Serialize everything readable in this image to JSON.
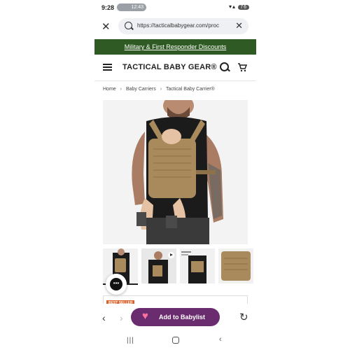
{
  "status_bar": {
    "time": "9:28",
    "pill_text": "12:43",
    "battery": "76"
  },
  "browser": {
    "url": "https://tacticalbabygear.com/proc"
  },
  "promo_banner": "Military & First Responder Discounts",
  "header": {
    "logo": "TACTICAL BABY GEAR®"
  },
  "breadcrumb": {
    "items": [
      "Home",
      "Baby Carriers",
      "Tactical Baby Carrier®"
    ]
  },
  "product": {
    "badge": "BEST SELLER"
  },
  "bottom_bar": {
    "babylist_label": "Add to Babylist"
  },
  "icons": {
    "close": "close-icon",
    "search": "search-icon",
    "cart": "cart-icon",
    "menu": "hamburger-icon",
    "back": "chevron-left-icon",
    "forward": "chevron-right-icon",
    "reload": "reload-icon",
    "chat": "chat-icon",
    "heart": "heart-icon"
  },
  "colors": {
    "promo_bg": "#2f5a23",
    "babylist_bg": "#6b2c6f",
    "badge_bg": "#d9622b",
    "carrier_tan": "#a88a5c"
  }
}
